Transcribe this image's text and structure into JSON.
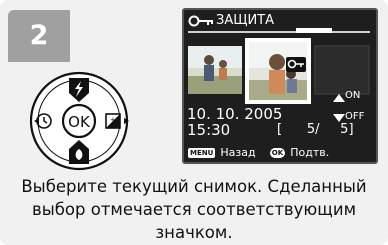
{
  "step_number": "2",
  "dpad": {
    "center_label": "OK",
    "top_icon": "flash-icon",
    "left_icon": "self-timer-icon",
    "right_icon": "exposure-compensation-icon",
    "bottom_icon": "macro-icon"
  },
  "screen": {
    "header": {
      "icon": "key-protect-icon",
      "title": "ЗАЩИТА"
    },
    "date": "10. 10. 2005",
    "time": "15:30",
    "counter": "[      5/     5]",
    "on_label": "ON",
    "off_label": "OFF",
    "footer": {
      "menu_key": "MENU",
      "back_label": "Назад",
      "ok_key": "OK",
      "confirm_label": "Подтв."
    }
  },
  "caption": {
    "line1": "Выберите текущий снимок. Сделанный",
    "line2": "выбор отмечается соответствующим",
    "line3": "значком."
  },
  "colors": {
    "panel": "#f1f1f1",
    "step_badge": "#a0a0a0",
    "screen_bg": "#1e1e1e",
    "thumb_selected_border": "#ffffff"
  }
}
